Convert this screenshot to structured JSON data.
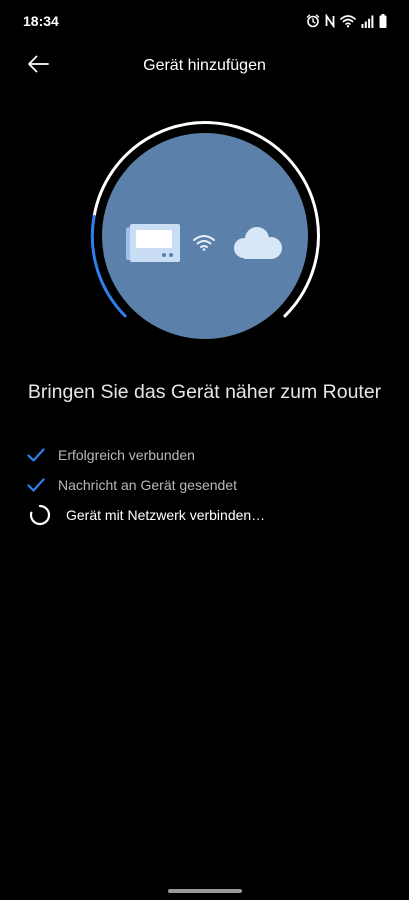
{
  "status_bar": {
    "time": "18:34",
    "icons": [
      "alarm-icon",
      "nfc-icon",
      "wifi-icon",
      "cellular-signal-icon",
      "battery-icon"
    ]
  },
  "header": {
    "back_icon": "arrow-left-icon",
    "title": "Gerät hinzufügen"
  },
  "illustration": {
    "icons": [
      "device-display-icon",
      "wifi-icon",
      "cloud-icon"
    ],
    "colors": {
      "circle": "#5b81aa",
      "ring": "#ffffff",
      "progress": "#2f80ed"
    }
  },
  "headline": "Bringen Sie das Gerät näher zum Router",
  "steps": [
    {
      "label": "Erfolgreich verbunden",
      "status": "done",
      "icon": "checkmark-icon"
    },
    {
      "label": "Nachricht an Gerät gesendet",
      "status": "done",
      "icon": "checkmark-icon"
    },
    {
      "label": "Gerät mit Netzwerk verbinden…",
      "status": "in-progress",
      "icon": "loading-spinner-icon"
    }
  ],
  "accent_color": "#2f80ed"
}
